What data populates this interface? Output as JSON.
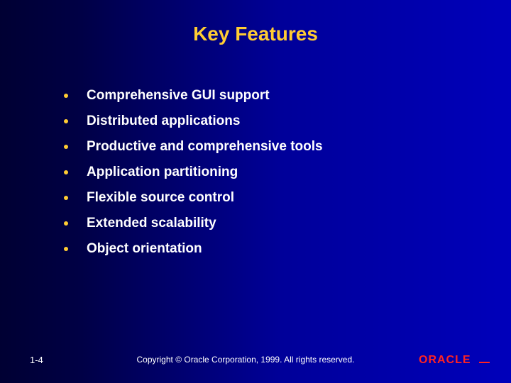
{
  "title": "Key Features",
  "bullets": [
    "Comprehensive GUI support",
    "Distributed applications",
    "Productive and comprehensive tools",
    "Application partitioning",
    "Flexible source control",
    "Extended scalability",
    "Object orientation"
  ],
  "page_number": "1-4",
  "copyright": "Copyright © Oracle Corporation, 1999. All rights reserved.",
  "logo_text": "ORACLE"
}
